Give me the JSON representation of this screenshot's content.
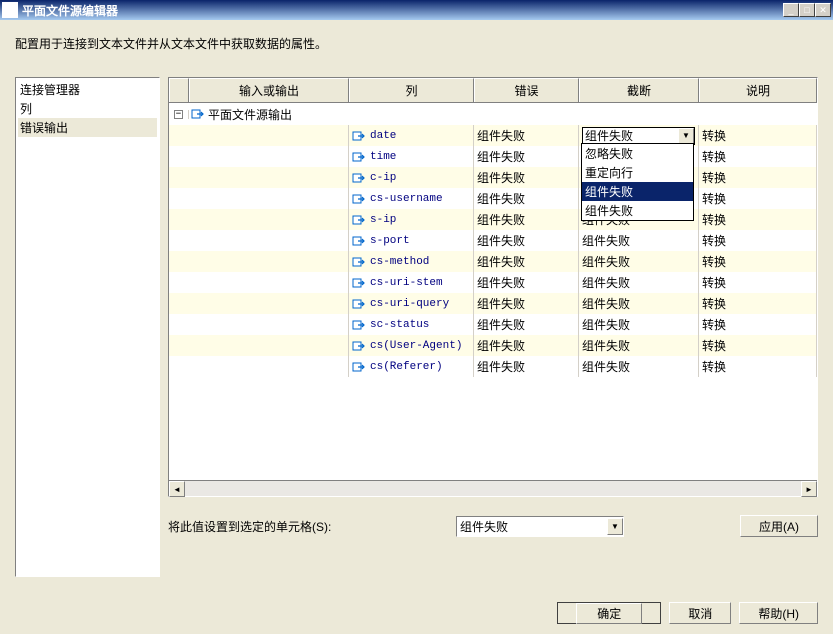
{
  "title": "平面文件源编辑器",
  "description": "配置用于连接到文本文件并从文本文件中获取数据的属性。",
  "sidebar": {
    "items": [
      {
        "label": "连接管理器"
      },
      {
        "label": "列"
      },
      {
        "label": "错误输出"
      }
    ],
    "selected_index": 2
  },
  "grid": {
    "headers": {
      "io": "输入或输出",
      "col": "列",
      "err": "错误",
      "trunc": "截断",
      "desc": "说明"
    },
    "parent_label": "平面文件源输出",
    "rows": [
      {
        "col": "date",
        "err": "组件失败",
        "trunc": "组件失败",
        "desc": "转换",
        "trunc_active": true
      },
      {
        "col": "time",
        "err": "组件失败",
        "trunc": "组件失败",
        "desc": "转换"
      },
      {
        "col": "c-ip",
        "err": "组件失败",
        "trunc": "组件失败",
        "desc": "转换"
      },
      {
        "col": "cs-username",
        "err": "组件失败",
        "trunc": "组件失败",
        "desc": "转换"
      },
      {
        "col": "s-ip",
        "err": "组件失败",
        "trunc": "组件失败",
        "desc": "转换"
      },
      {
        "col": "s-port",
        "err": "组件失败",
        "trunc": "组件失败",
        "desc": "转换"
      },
      {
        "col": "cs-method",
        "err": "组件失败",
        "trunc": "组件失败",
        "desc": "转换"
      },
      {
        "col": "cs-uri-stem",
        "err": "组件失败",
        "trunc": "组件失败",
        "desc": "转换"
      },
      {
        "col": "cs-uri-query",
        "err": "组件失败",
        "trunc": "组件失败",
        "desc": "转换"
      },
      {
        "col": "sc-status",
        "err": "组件失败",
        "trunc": "组件失败",
        "desc": "转换"
      },
      {
        "col": "cs(User-Agent)",
        "err": "组件失败",
        "trunc": "组件失败",
        "desc": "转换"
      },
      {
        "col": "cs(Referer)",
        "err": "组件失败",
        "trunc": "组件失败",
        "desc": "转换"
      }
    ],
    "dropdown_options": [
      "忽略失败",
      "重定向行",
      "组件失败",
      "组件失败"
    ],
    "dropdown_highlight_index": 2
  },
  "bottom": {
    "label": "将此值设置到选定的单元格(S):",
    "select_value": "组件失败",
    "apply_label": "应用(A)"
  },
  "footer": {
    "ok": "确定",
    "cancel": "取消",
    "help": "帮助(H)"
  }
}
